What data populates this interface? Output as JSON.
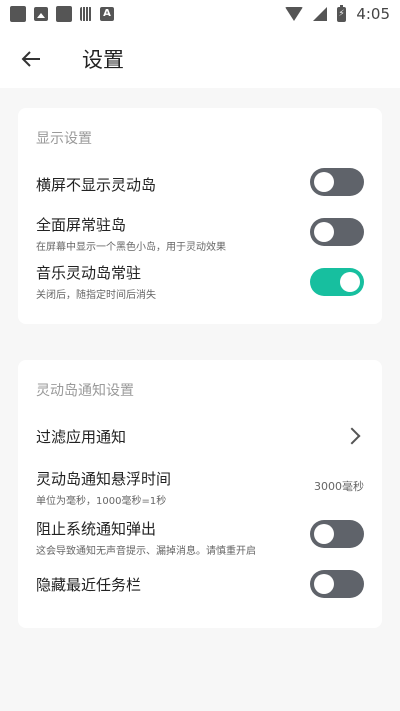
{
  "status_bar": {
    "time": "4:05",
    "battery_glyph": "⚡"
  },
  "app_bar": {
    "title": "设置"
  },
  "sections": [
    {
      "title": "显示设置",
      "items": [
        {
          "label": "横屏不显示灵动岛",
          "toggle": false
        },
        {
          "label": "全面屏常驻岛",
          "subtitle": "在屏幕中显示一个黑色小岛，用于灵动效果",
          "toggle": false
        },
        {
          "label": "音乐灵动岛常驻",
          "subtitle": "关闭后，随指定时间后消失",
          "toggle": true
        }
      ]
    },
    {
      "title": "灵动岛通知设置",
      "items": [
        {
          "label": "过滤应用通知"
        },
        {
          "label": "灵动岛通知悬浮时间",
          "subtitle": "单位为毫秒，1000毫秒=1秒",
          "value": "3000毫秒"
        },
        {
          "label": "阻止系统通知弹出",
          "subtitle": "这会导致通知无声音提示、漏掉消息。请慎重开启",
          "toggle": false
        },
        {
          "label": "隐藏最近任务栏",
          "toggle": false
        }
      ]
    }
  ],
  "colors": {
    "accent": "#17bf9f",
    "toggle_off": "#5f636a",
    "background": "#f7f7f7"
  }
}
